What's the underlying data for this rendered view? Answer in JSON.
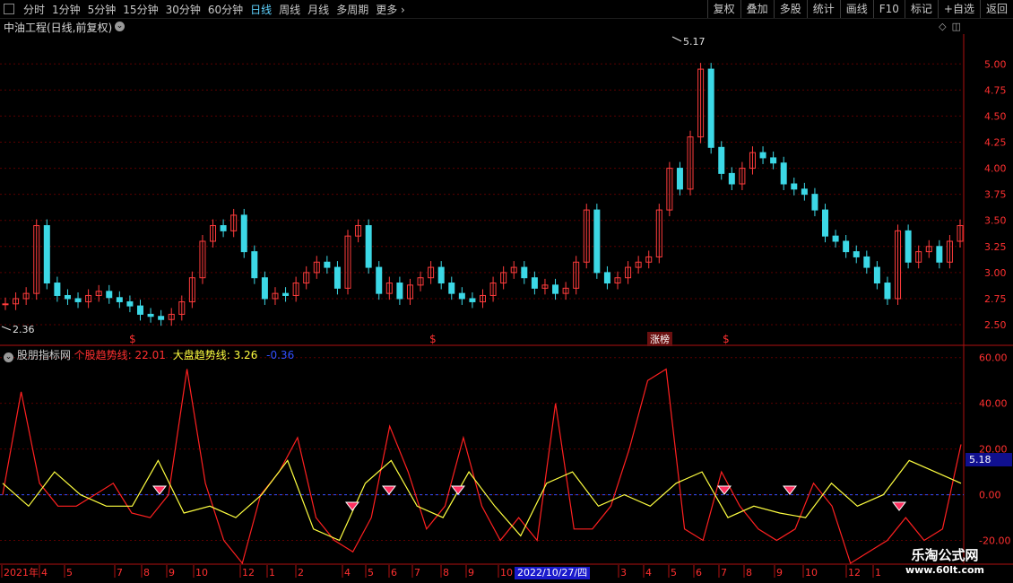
{
  "toolbar": {
    "periods": [
      "分时",
      "1分钟",
      "5分钟",
      "15分钟",
      "30分钟",
      "60分钟",
      "日线",
      "周线",
      "月线",
      "多周期",
      "更多"
    ],
    "active_period": "日线",
    "buttons": [
      "复权",
      "叠加",
      "多股",
      "统计",
      "画线",
      "F10",
      "标记",
      "+自选",
      "返回"
    ]
  },
  "main": {
    "title": "中油工程(日线,前复权)",
    "high_label": "5.17",
    "low_label": "2.36",
    "zhangting_label": "涨榜",
    "price_ticks": [
      "5.00",
      "4.75",
      "4.50",
      "4.25",
      "4.00",
      "3.75",
      "3.50",
      "3.25",
      "3.00",
      "2.75",
      "2.50"
    ],
    "markers": [
      "$",
      "$",
      "$"
    ]
  },
  "indicator": {
    "name": "股朋指标网",
    "line1_label": "个股趋势线:",
    "line1_value": "22.01",
    "line2_label": "大盘趋势线:",
    "line2_value": "3.26",
    "line3_value": "-0.36",
    "ticks": [
      "60.00",
      "40.00",
      "20.00",
      "0.00",
      "-20.00"
    ],
    "current_tag": "5.18"
  },
  "timeline": {
    "labels": [
      "2021年",
      "4",
      "5",
      "7",
      "8",
      "9",
      "10",
      "12",
      "1",
      "2",
      "4",
      "5",
      "6",
      "7",
      "8",
      "9",
      "10",
      "3",
      "4",
      "5",
      "6",
      "7",
      "8",
      "9",
      "10",
      "12",
      "1"
    ],
    "cursor_label": "2022/10/27/四"
  },
  "watermark": {
    "line1": "乐淘公式网",
    "line2": "www.60lt.com"
  },
  "colors": {
    "up": "#ff3c3c",
    "down": "#3cd8e6",
    "indicator_red": "#ff2020",
    "indicator_yellow": "#ffff40",
    "axis_red": "#ff3030"
  },
  "chart_data": {
    "type": "line",
    "price_range": [
      2.36,
      5.17
    ],
    "indicator_range": [
      -30,
      65
    ],
    "price_series": [
      2.7,
      2.75,
      2.8,
      3.45,
      2.9,
      2.78,
      2.75,
      2.72,
      2.78,
      2.82,
      2.76,
      2.72,
      2.68,
      2.6,
      2.58,
      2.55,
      2.6,
      2.72,
      2.95,
      3.3,
      3.45,
      3.4,
      3.55,
      3.2,
      2.95,
      2.75,
      2.8,
      2.78,
      2.9,
      3.0,
      3.1,
      3.05,
      2.85,
      3.35,
      3.45,
      3.05,
      2.8,
      2.9,
      2.75,
      2.88,
      2.95,
      3.05,
      2.9,
      2.8,
      2.75,
      2.72,
      2.78,
      2.9,
      3.0,
      3.05,
      2.95,
      2.85,
      2.88,
      2.8,
      2.85,
      3.1,
      3.6,
      3.0,
      2.9,
      2.95,
      3.05,
      3.1,
      3.15,
      3.6,
      4.0,
      3.8,
      4.3,
      4.95,
      4.2,
      3.95,
      3.85,
      4.0,
      4.15,
      4.1,
      4.05,
      3.85,
      3.8,
      3.75,
      3.6,
      3.35,
      3.3,
      3.2,
      3.15,
      3.05,
      2.9,
      2.75,
      3.4,
      3.1,
      3.2,
      3.25,
      3.1,
      3.3,
      3.45
    ],
    "indicator_red": [
      0,
      45,
      5,
      -5,
      -5,
      0,
      5,
      -8,
      -10,
      0,
      55,
      5,
      -20,
      -30,
      0,
      10,
      25,
      -10,
      -20,
      -25,
      -10,
      30,
      10,
      -15,
      -5,
      25,
      -5,
      -20,
      -10,
      -20,
      40,
      -15,
      -15,
      -5,
      20,
      50,
      55,
      -15,
      -20,
      10,
      -5,
      -15,
      -20,
      -15,
      5,
      -5,
      -30,
      -25,
      -20,
      -10,
      -20,
      -15,
      22
    ],
    "indicator_yellow": [
      5,
      -5,
      10,
      0,
      -5,
      -5,
      15,
      -8,
      -5,
      -10,
      0,
      15,
      -15,
      -20,
      5,
      15,
      -5,
      -10,
      10,
      -5,
      -18,
      5,
      10,
      -5,
      0,
      -5,
      5,
      10,
      -10,
      -5,
      -8,
      -10,
      5,
      -5,
      0,
      15,
      10,
      5
    ]
  }
}
